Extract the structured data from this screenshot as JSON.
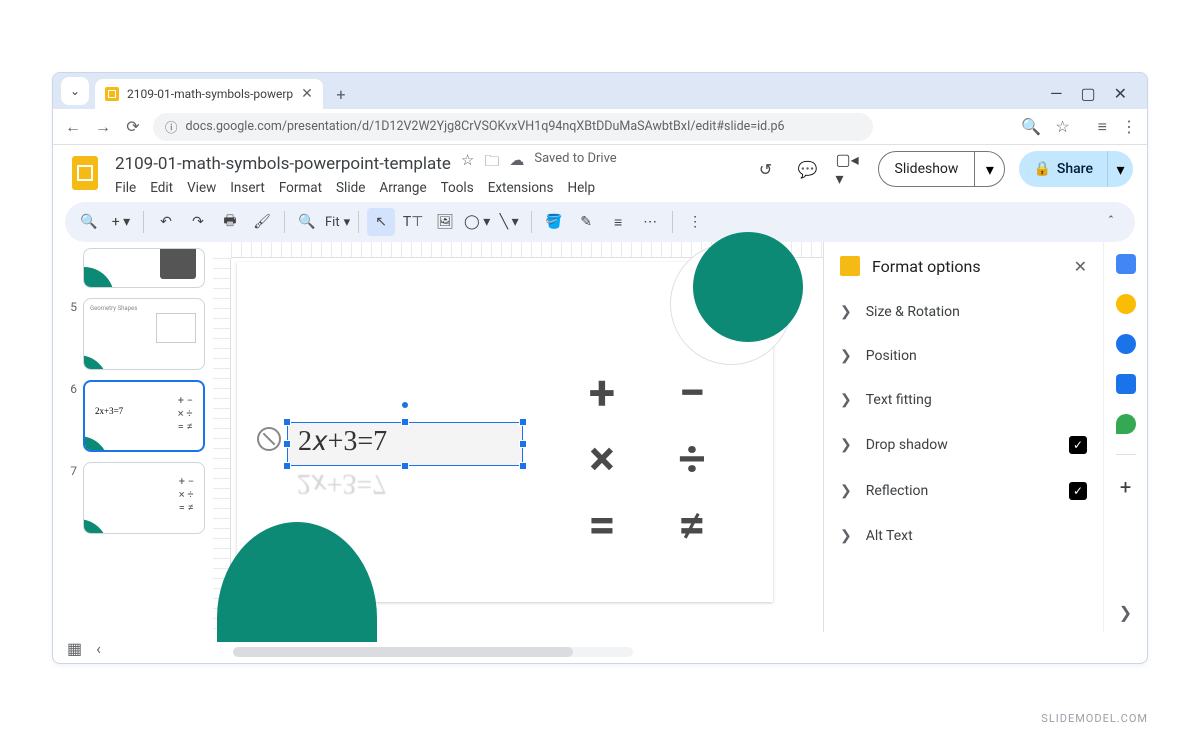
{
  "browser": {
    "tab_title": "2109-01-math-symbols-powerp",
    "url": "docs.google.com/presentation/d/1D12V2W2Yjg8CrVSOKvxVH1q94nqXBtDDuMaSAwbtBxI/edit#slide=id.p6"
  },
  "header": {
    "doc_title": "2109-01-math-symbols-powerpoint-template",
    "save_status": "Saved to Drive",
    "menu": [
      "File",
      "Edit",
      "View",
      "Insert",
      "Format",
      "Slide",
      "Arrange",
      "Tools",
      "Extensions",
      "Help"
    ],
    "slideshow": "Slideshow",
    "share": "Share"
  },
  "toolbar": {
    "zoom": "Fit"
  },
  "filmstrip": {
    "slides": [
      {
        "num": "",
        "label": ""
      },
      {
        "num": "5",
        "label": "Geometry Shapes"
      },
      {
        "num": "6",
        "label": "2x+3=7"
      },
      {
        "num": "7",
        "label": ""
      }
    ]
  },
  "slide": {
    "equation": "2𝑥+3=7",
    "symbols": [
      "+",
      "−",
      "×",
      "÷",
      "=",
      "≠"
    ]
  },
  "format_panel": {
    "title": "Format options",
    "items": [
      {
        "label": "Size & Rotation",
        "checked": false
      },
      {
        "label": "Position",
        "checked": false
      },
      {
        "label": "Text fitting",
        "checked": false
      },
      {
        "label": "Drop shadow",
        "checked": true
      },
      {
        "label": "Reflection",
        "checked": true
      },
      {
        "label": "Alt Text",
        "checked": false
      }
    ]
  },
  "watermark": "SLIDEMODEL.COM"
}
